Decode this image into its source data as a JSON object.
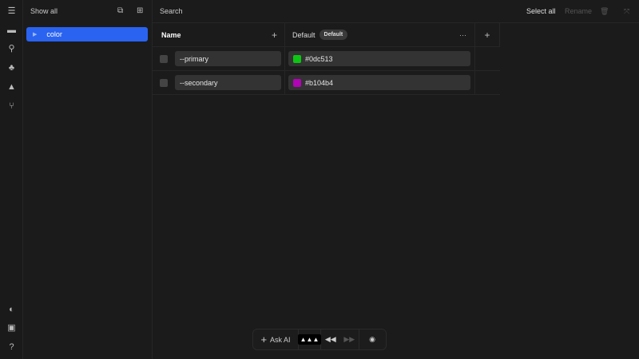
{
  "sidebar": {
    "header": "Show all",
    "items": [
      {
        "label": "color"
      }
    ]
  },
  "toolbar": {
    "search": "Search",
    "select_all": "Select all",
    "rename": "Rename"
  },
  "table": {
    "name_header": "Name",
    "mode_header": "Default",
    "mode_badge": "Default",
    "rows": [
      {
        "name": "--primary",
        "value": "#0dc513",
        "color": "#0dc513"
      },
      {
        "name": "--secondary",
        "value": "#b104b4",
        "color": "#b104b4"
      }
    ]
  },
  "bottom_bar": {
    "ask_ai": "Ask AI"
  }
}
